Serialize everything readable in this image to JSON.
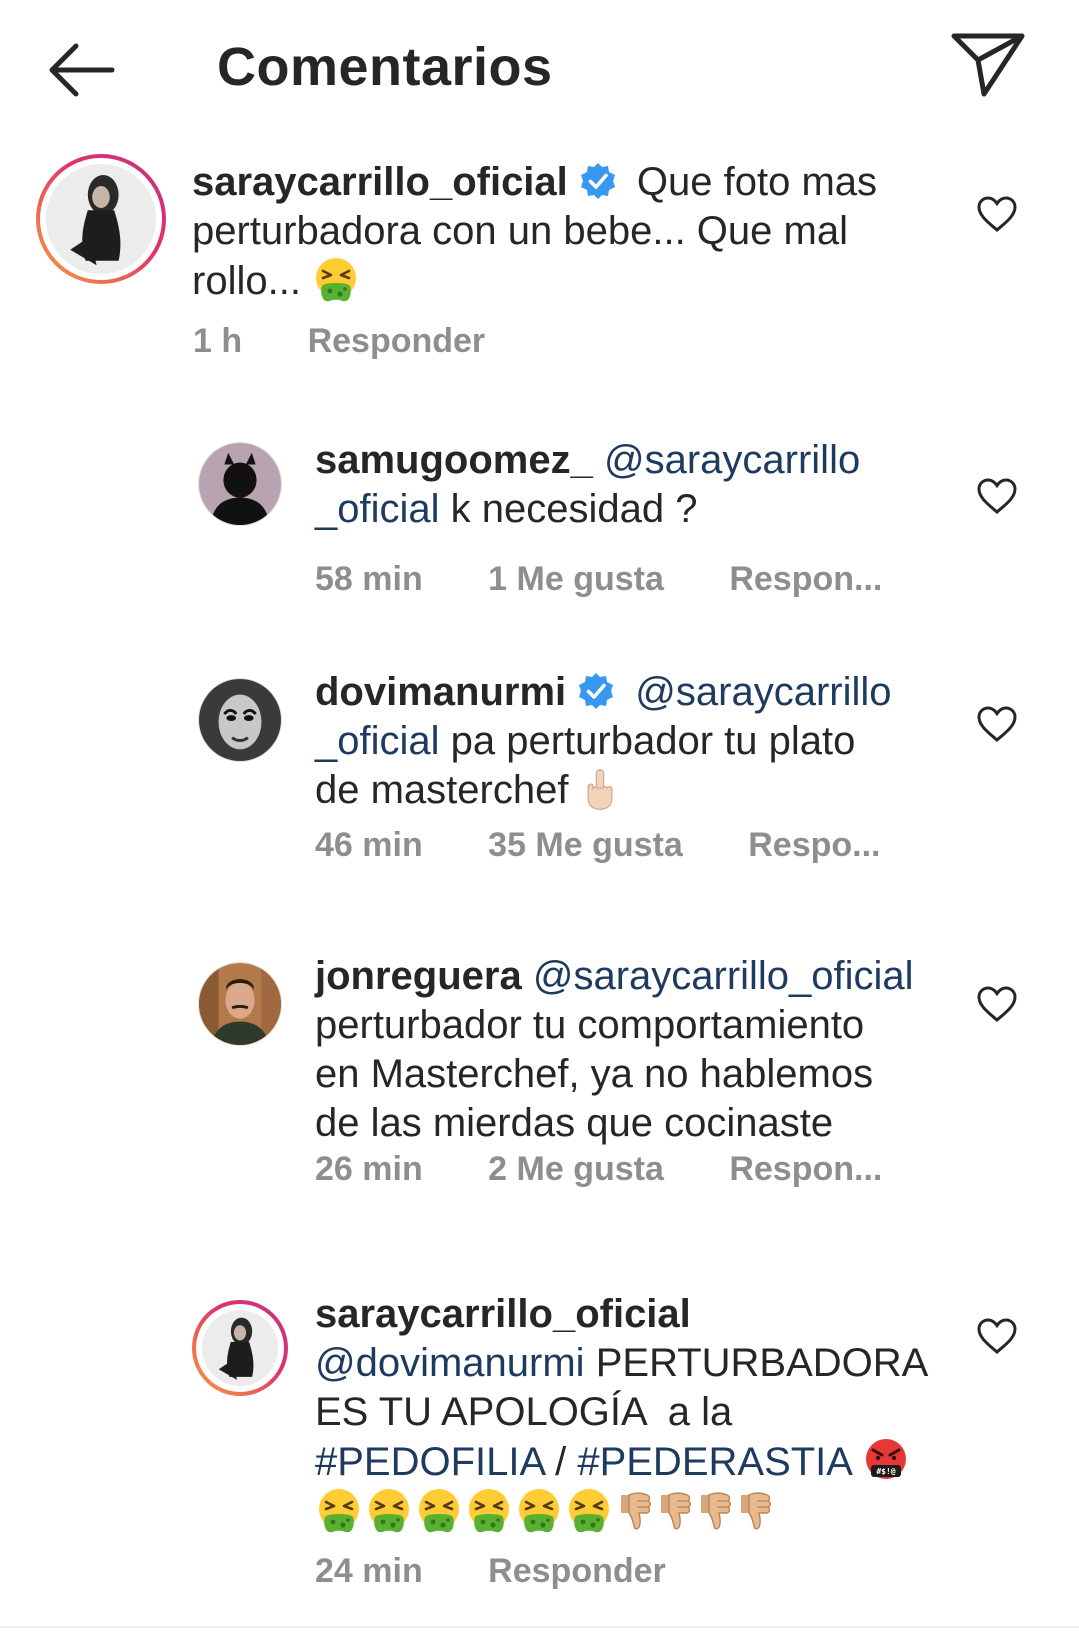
{
  "header": {
    "title": "Comentarios",
    "back_icon": "arrow-left-icon",
    "send_icon": "paper-plane-icon"
  },
  "comments": [
    {
      "username": "saraycarrillo_oficial",
      "verified": true,
      "text": "Que foto mas perturbadora con un bebe... Que mal rollo...",
      "emoji": [
        "vomiting-face"
      ],
      "time": "1 h",
      "likes": "",
      "reply": "Responder"
    },
    {
      "username": "samugoomez_",
      "verified": false,
      "mention": "@saraycarrillo _oficial",
      "mention_part1": "@saraycarrillo",
      "mention_part2": "_oficial",
      "text": "k necesidad ?",
      "time": "58 min",
      "likes": "1 Me gusta",
      "reply": "Respon..."
    },
    {
      "username": "dovimanurmi",
      "verified": true,
      "mention_part1": "@saraycarrillo",
      "mention_part2": "_oficial",
      "text1": "pa perturbador tu plato",
      "text2": "de masterchef",
      "emoji": [
        "middle-finger"
      ],
      "time": "46 min",
      "likes": "35 Me gusta",
      "reply": "Respo..."
    },
    {
      "username": "jonreguera",
      "verified": false,
      "mention": "@saraycarrillo_oficial",
      "line2": "perturbador tu comportamiento",
      "line3": "en Masterchef, ya no hablemos",
      "line4": "de las mierdas que cocinaste",
      "time": "26 min",
      "likes": "2 Me gusta",
      "reply": "Respon..."
    },
    {
      "username": "saraycarrillo_oficial",
      "verified": false,
      "mention": "@dovimanurmi",
      "text1": "PERTURBADORA",
      "text2": "ES TU APOLOGÍA  a la",
      "hashtag1": "#PEDOFILIA",
      "separator": " / ",
      "hashtag2": "#PEDERASTIA",
      "emoji": [
        "angry-cursing-face",
        "vomiting-face x6",
        "thumbs-down x4"
      ],
      "time": "24 min",
      "likes": "",
      "reply": "Responder"
    }
  ],
  "colors": {
    "text": "#262626",
    "meta": "#8e8e8e",
    "mention": "#1e3a5f",
    "verified": "#3897f0",
    "story_ring": "#e1306c"
  }
}
